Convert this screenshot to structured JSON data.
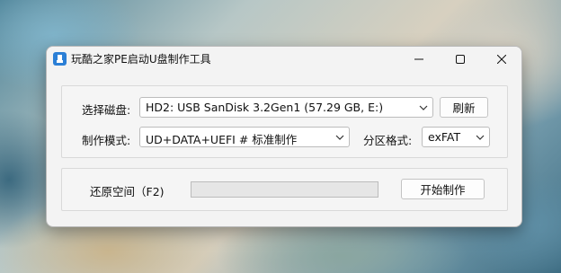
{
  "window": {
    "title": "玩酷之家PE启动U盘制作工具",
    "controls": {
      "minimize": "minimize-icon",
      "maximize": "maximize-icon",
      "close": "close-icon"
    }
  },
  "disk": {
    "label": "选择磁盘:",
    "selected": "HD2: USB SanDisk 3.2Gen1 (57.29 GB, E:)",
    "refresh_label": "刷新"
  },
  "mode": {
    "label": "制作模式:",
    "selected": "UD+DATA+UEFI # 标准制作"
  },
  "partition": {
    "label": "分区格式:",
    "selected": "exFAT"
  },
  "restore": {
    "label": "还原空间（F2)"
  },
  "progress": {
    "value": 0
  },
  "start_label": "开始制作",
  "colors": {
    "accent": "#2b7fd6",
    "progress_fill": "#06b025"
  }
}
